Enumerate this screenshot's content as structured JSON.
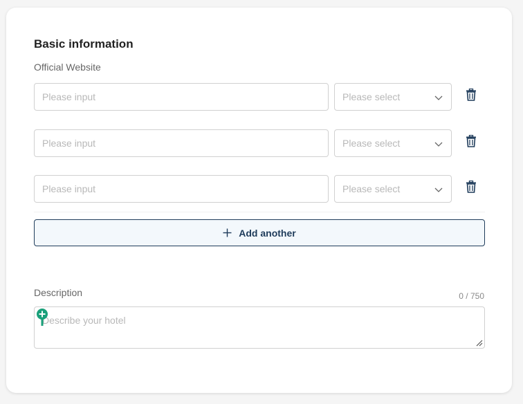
{
  "section": {
    "title": "Basic information",
    "website_label": "Official Website",
    "rows": [
      {
        "input_placeholder": "Please input",
        "select_placeholder": "Please select"
      },
      {
        "input_placeholder": "Please input",
        "select_placeholder": "Please select"
      },
      {
        "input_placeholder": "Please input",
        "select_placeholder": "Please select"
      }
    ],
    "add_button_label": "Add another",
    "description_label": "Description",
    "description_counter": "0 / 750",
    "description_placeholder": "Describe your hotel"
  },
  "icons": {
    "delete": "trash-icon",
    "dropdown": "chevron-down-icon",
    "add": "plus-icon",
    "resize": "resize-handle-icon",
    "cursor": "add-cursor-icon"
  },
  "colors": {
    "accent": "#1e3b5a",
    "add_button_bg": "#f3f8fc",
    "cursor_green": "#1aa07a"
  }
}
